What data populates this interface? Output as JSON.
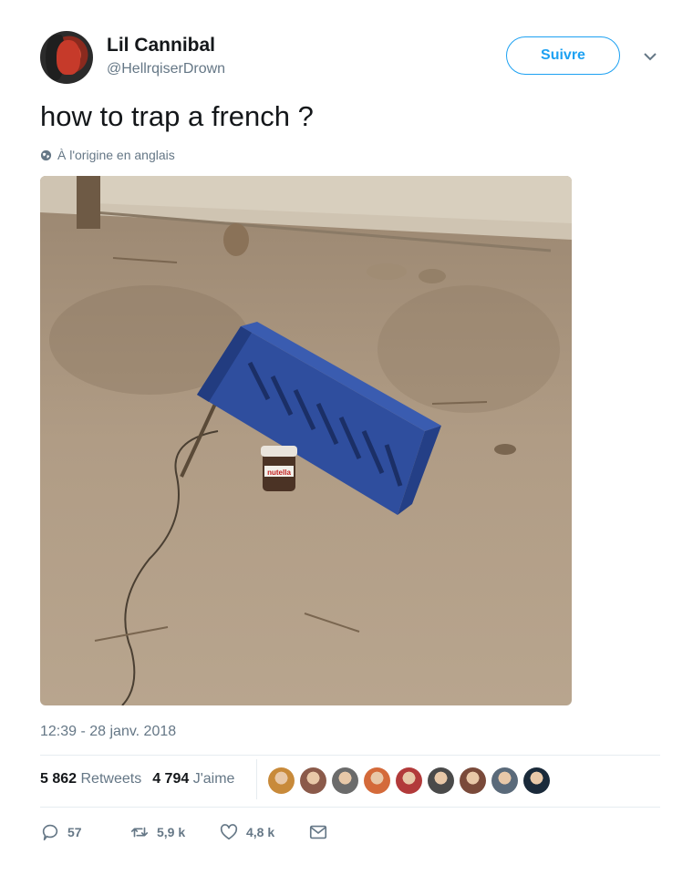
{
  "user": {
    "name": "Lil Cannibal",
    "handle": "@HellrqiserDrown"
  },
  "follow_label": "Suivre",
  "tweet_text": "how to trap a french ?",
  "translate_note": "À l'origine en anglais",
  "timestamp": "12:39 - 28 janv. 2018",
  "stats": {
    "retweets_count": "5 862",
    "retweets_label": "Retweets",
    "likes_count": "4 794",
    "likes_label": "J'aime"
  },
  "likers": [
    "#c88a3a",
    "#8b5a4a",
    "#6b6b6b",
    "#d46a3a",
    "#b23a3a",
    "#4a4a4a",
    "#7a4a3a",
    "#5a6a7a",
    "#1a2a3a"
  ],
  "actions": {
    "replies": "57",
    "retweets": "5,9 k",
    "likes": "4,8 k"
  },
  "colors": {
    "accent": "#1da1f2",
    "muted": "#657786",
    "text": "#14171a"
  }
}
